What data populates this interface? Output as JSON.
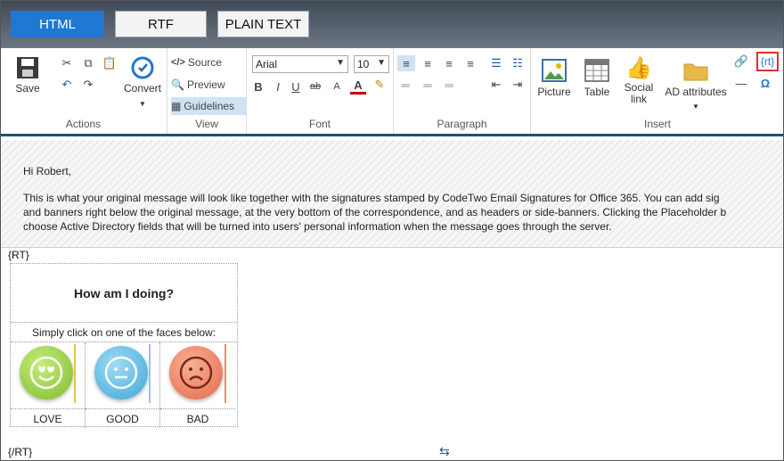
{
  "modes": [
    {
      "label": "HTML",
      "active": true
    },
    {
      "label": "RTF",
      "active": false
    },
    {
      "label": "PLAIN TEXT",
      "active": false
    }
  ],
  "ribbon": {
    "actions": {
      "label": "Actions",
      "save": "Save",
      "convert": "Convert"
    },
    "view": {
      "label": "View",
      "source": "Source",
      "preview": "Preview",
      "guidelines": "Guidelines"
    },
    "font": {
      "label": "Font",
      "family": "Arial",
      "size": "10"
    },
    "paragraph": {
      "label": "Paragraph"
    },
    "insert": {
      "label": "Insert",
      "picture": "Picture",
      "table": "Table",
      "social_line1": "Social",
      "social_line2": "link",
      "ad_attributes": "AD attributes",
      "rt_token": "{rt}",
      "omega": "Ω"
    }
  },
  "message": {
    "greeting": "Hi Robert,",
    "line1": "This is what your original message will look like together with the signatures stamped by CodeTwo Email Signatures for Office 365. You can add sig",
    "line2": "and banners right below the original message, at the very bottom of the correspondence, and as headers or side-banners. Clicking the Placeholder b",
    "line3": "choose Active Directory fields that will be turned into users' personal information when the message goes through the server."
  },
  "signature": {
    "open_tag": "{RT}",
    "close_tag": "{/RT}",
    "title": "How am I doing?",
    "subtitle": "Simply click on one of the faces below:",
    "faces": [
      {
        "label": "LOVE",
        "color": "#8cc63f"
      },
      {
        "label": "GOOD",
        "color": "#4ab3df"
      },
      {
        "label": "BAD",
        "color": "#ef7f5a"
      }
    ]
  }
}
